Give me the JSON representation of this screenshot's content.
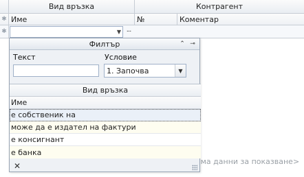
{
  "grid": {
    "band_left": "Вид връзка",
    "band_right": "Контрагент",
    "col_name": "Име",
    "col_num": "№",
    "col_comment": "Коментар",
    "filter_ellipsis": "···",
    "empty_message": "яма данни за показване>"
  },
  "popup": {
    "title": "Филтър",
    "text_label": "Текст",
    "text_value": "",
    "condition_label": "Условие",
    "condition_value": "1. Започва",
    "list_band": "Вид връзка",
    "list_col": "Име",
    "rows": [
      "е собственик на",
      "може да е издател на фактури",
      "е консигнант",
      "е банка"
    ]
  }
}
